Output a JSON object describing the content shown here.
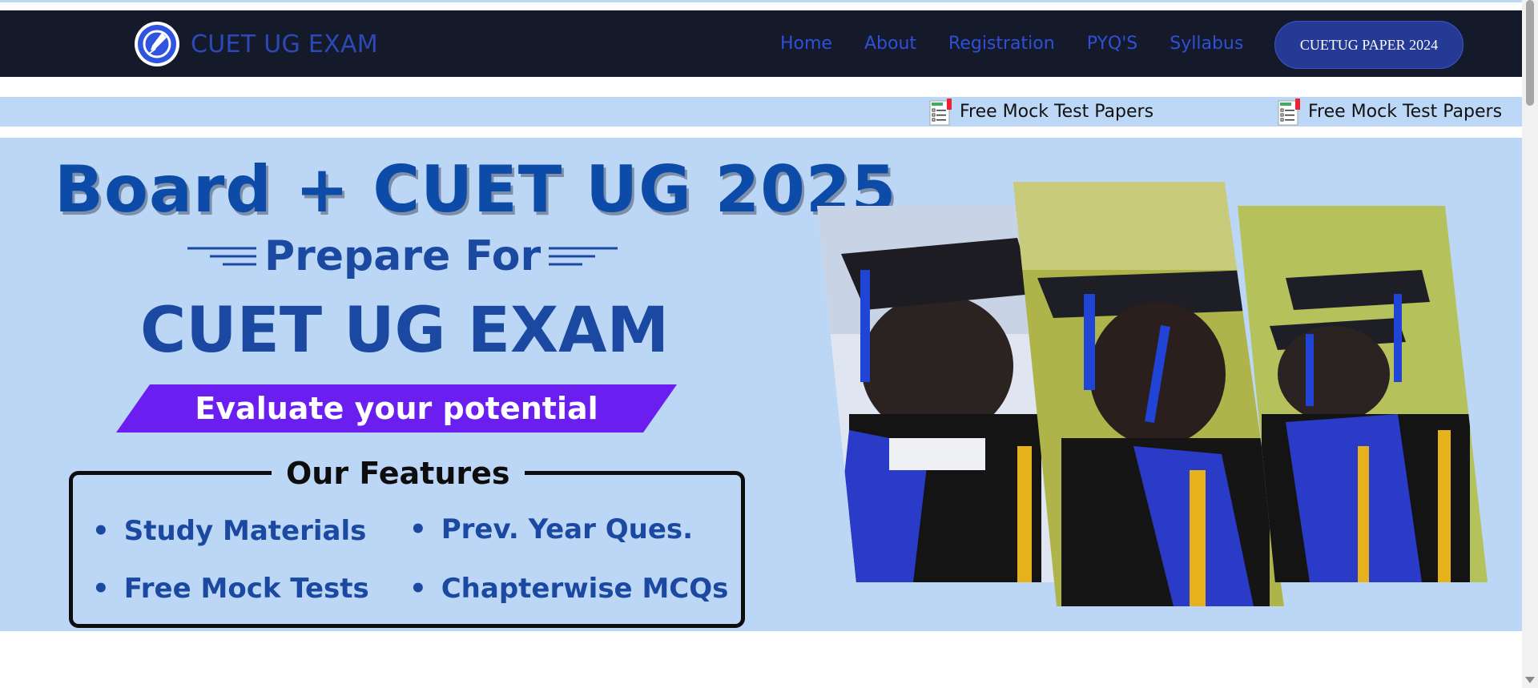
{
  "header": {
    "brand_name": "CUET UG EXAM",
    "logo_icon": "pen-nib-icon",
    "nav": [
      {
        "label": "Home"
      },
      {
        "label": "About"
      },
      {
        "label": "Registration"
      },
      {
        "label": "PYQ'S"
      },
      {
        "label": "Syllabus"
      }
    ],
    "cta_label": "CUETUG PAPER 2024"
  },
  "ticker": {
    "items": [
      {
        "icon": "test-paper-icon",
        "label": "Free Mock Test Papers"
      },
      {
        "icon": "test-paper-icon",
        "label": "Free Mock Test Papers"
      }
    ]
  },
  "banner": {
    "title": "Board + CUET UG 2025",
    "prepare": "Prepare For",
    "exam": "CUET UG EXAM",
    "ribbon": "Evaluate your potential",
    "features_title": "Our Features",
    "features": [
      "Study Materials",
      "Prev. Year Ques.",
      "Free Mock Tests",
      "Chapterwise MCQs"
    ],
    "image_subject": "graduates-in-caps-and-gowns"
  },
  "colors": {
    "navbar_bg": "#151a2b",
    "nav_link": "#2f4fd8",
    "banner_bg": "#bcd7f5",
    "title_blue": "#0d4ba8",
    "ribbon_purple": "#6a1ff0"
  }
}
